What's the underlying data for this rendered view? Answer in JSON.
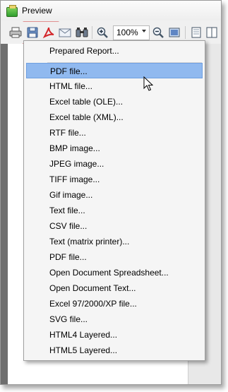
{
  "window": {
    "title": "Preview"
  },
  "toolbar": {
    "zoom_value": "100%",
    "icons": [
      "printer-icon",
      "save-icon",
      "pdf-icon",
      "email-icon",
      "find-icon",
      "zoom-in-icon",
      "zoom-out-icon",
      "page-view-icon",
      "single-page-icon",
      "two-page-icon"
    ]
  },
  "menu": {
    "items": [
      "Prepared Report...",
      "PDF file...",
      "HTML file...",
      "Excel table (OLE)...",
      "Excel table (XML)...",
      "RTF file...",
      "BMP image...",
      "JPEG image...",
      "TIFF image...",
      "Gif image...",
      "Text file...",
      "CSV file...",
      "Text (matrix printer)...",
      "PDF file...",
      "Open Document Spreadsheet...",
      "Open Document Text...",
      "Excel 97/2000/XP file...",
      "SVG file...",
      "HTML4 Layered...",
      "HTML5 Layered..."
    ],
    "selected_index": 1
  },
  "colors": {
    "highlight": "#90b9ef",
    "save_highlight": "#f4b8b8",
    "pdf_red": "#d3262a"
  }
}
